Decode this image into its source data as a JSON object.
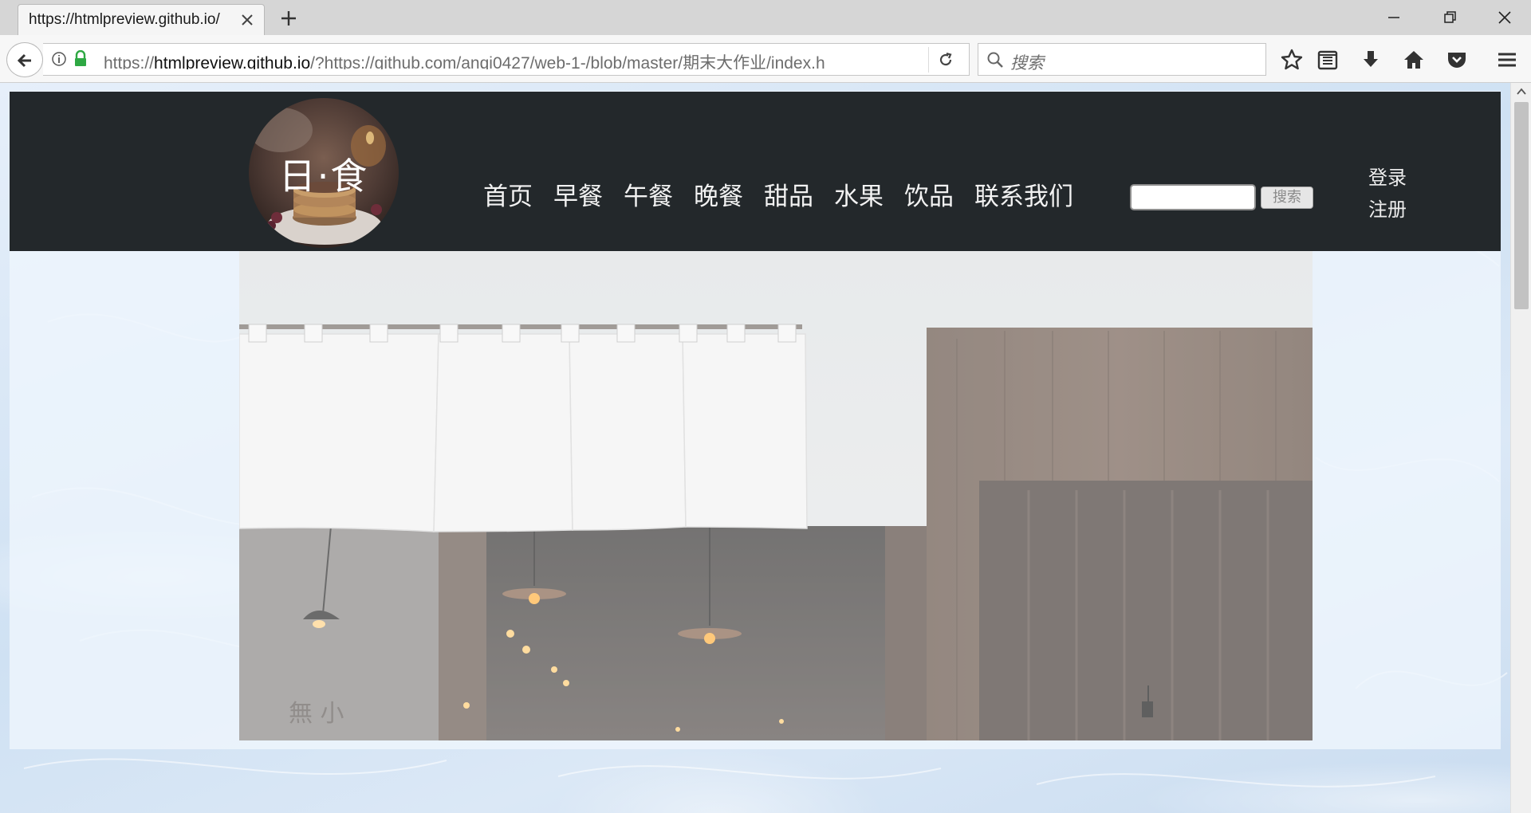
{
  "browser": {
    "tab": {
      "title": "https://htmlpreview.github.io/"
    },
    "url": {
      "scheme": "https://",
      "host": "htmlpreview.github.io",
      "rest": "/?https://github.com/anqi0427/web-1-/blob/master/期末大作业/index.h"
    },
    "search": {
      "placeholder": "搜索"
    },
    "toolbar_icons": [
      "star-icon",
      "reader-list-icon",
      "download-icon",
      "home-icon",
      "pocket-icon",
      "menu-icon"
    ]
  },
  "site": {
    "logo_text": "日·食",
    "nav": [
      "首页",
      "早餐",
      "午餐",
      "晚餐",
      "甜品",
      "水果",
      "饮品",
      "联系我们"
    ],
    "search_button": "搜索",
    "auth": {
      "login": "登录",
      "register": "注册"
    },
    "hero_sign": "無 小"
  },
  "colors": {
    "header_bg": "#23282b",
    "page_bg": "#cfe0f1",
    "lock_green": "#2ea843"
  }
}
